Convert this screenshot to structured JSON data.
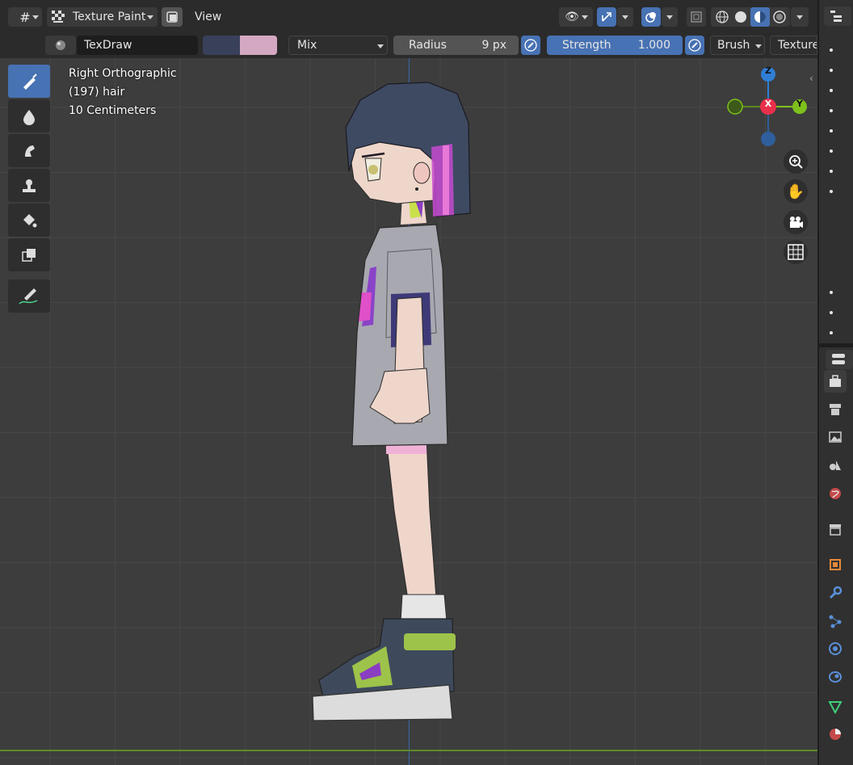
{
  "header": {
    "mode_label": "Texture Paint",
    "view_menu": "View"
  },
  "tool_settings": {
    "brush_name": "TexDraw",
    "primary_color": "#39405a",
    "secondary_color": "#d4a8c2",
    "blend_mode": "Mix",
    "radius_label": "Radius",
    "radius_value": "9 px",
    "strength_label": "Strength",
    "strength_value": "1.000",
    "brush_menu": "Brush",
    "texture_menu": "Texture"
  },
  "viewport": {
    "view_name": "Right Orthographic",
    "object_info": "(197) hair",
    "scale_info": "10 Centimeters",
    "gizmo": {
      "z": "Z",
      "x": "X",
      "y": "Y"
    }
  },
  "toolbar": {
    "tools": [
      "draw-tool",
      "soften-tool",
      "smear-tool",
      "clone-tool",
      "fill-tool",
      "mask-tool",
      "annotate-tool"
    ]
  },
  "colors": {
    "accent": "#4772b3",
    "axis_x": "#e8304a",
    "axis_y": "#7ec11c",
    "axis_z": "#2f7fd6"
  }
}
